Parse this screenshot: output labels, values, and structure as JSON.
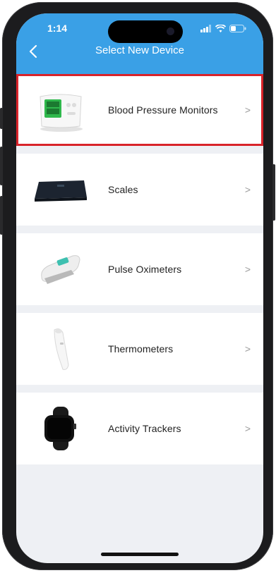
{
  "status_bar": {
    "time": "1:14"
  },
  "header": {
    "title": "Select New Device",
    "back_icon": "chevron-left-icon"
  },
  "devices": [
    {
      "label": "Blood Pressure Monitors",
      "icon": "blood-pressure-monitor-image",
      "highlighted": true
    },
    {
      "label": "Scales",
      "icon": "scale-image",
      "highlighted": false
    },
    {
      "label": "Pulse Oximeters",
      "icon": "pulse-oximeter-image",
      "highlighted": false
    },
    {
      "label": "Thermometers",
      "icon": "thermometer-image",
      "highlighted": false
    },
    {
      "label": "Activity Trackers",
      "icon": "activity-tracker-image",
      "highlighted": false
    }
  ],
  "chevron": ">",
  "colors": {
    "header": "#3aa0e6",
    "highlight": "#d9232a",
    "background": "#eef0f4"
  }
}
